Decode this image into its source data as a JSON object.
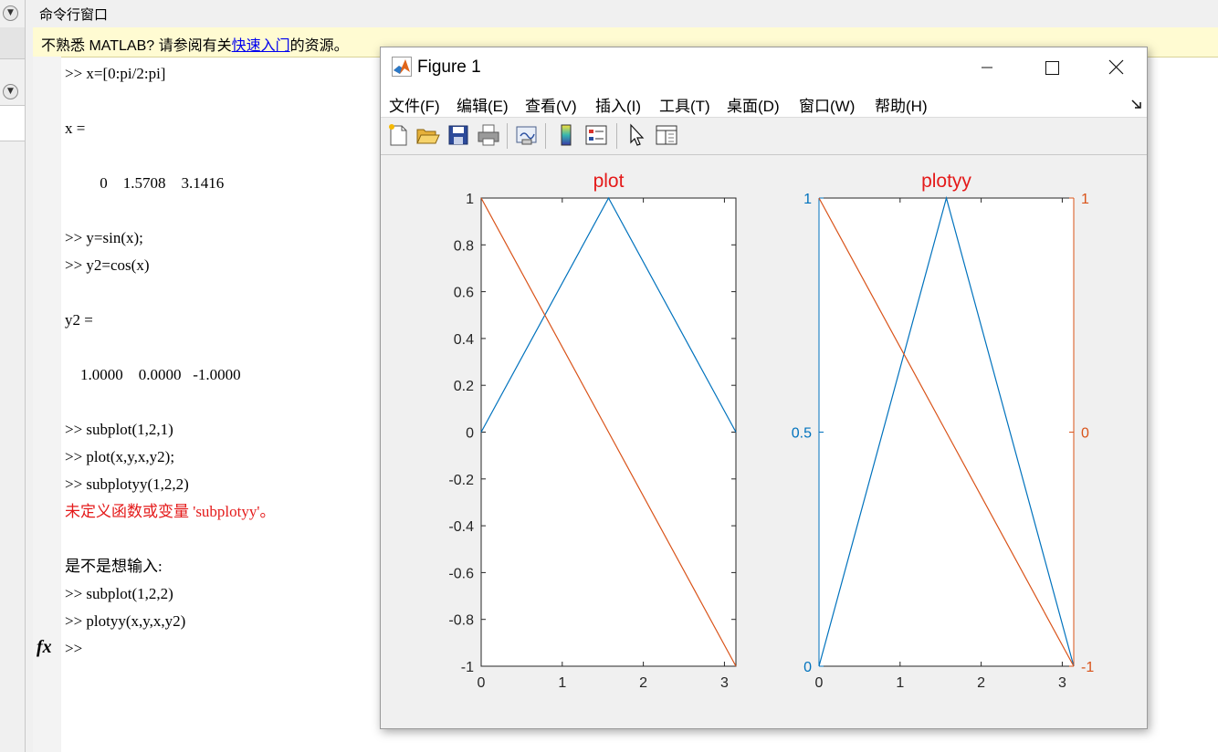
{
  "command_window": {
    "title": "命令行窗口",
    "info_prefix": "不熟悉 MATLAB? 请参阅有关",
    "info_link": "快速入门",
    "info_suffix": "的资源。",
    "lines": [
      ">> x=[0:pi/2:pi]",
      "x =",
      "         0    1.5708    3.1416",
      ">> y=sin(x);",
      ">> y2=cos(x)",
      "y2 =",
      "    1.0000    0.0000   -1.0000",
      ">> subplot(1,2,1)",
      ">> plot(x,y,x,y2);",
      ">> subplotyy(1,2,2)",
      "未定义函数或变量 'subplotyy'。",
      "是不是想输入:",
      ">> subplot(1,2,2)",
      ">> plotyy(x,y,x,y2)"
    ],
    "prompt": ">>",
    "fx_label": "fx"
  },
  "figure_window": {
    "title": "Figure 1",
    "menu": [
      "文件(F)",
      "编辑(E)",
      "查看(V)",
      "插入(I)",
      "工具(T)",
      "桌面(D)",
      "窗口(W)",
      "帮助(H)"
    ],
    "toolbar_icons": [
      "new-figure-icon",
      "open-file-icon",
      "save-icon",
      "print-icon",
      "link-plot-icon",
      "insert-colorbar-icon",
      "insert-legend-icon",
      "edit-plot-pointer-icon",
      "property-inspector-icon"
    ]
  },
  "colors": {
    "blue": "#0072bd",
    "orange": "#d95319",
    "title_red": "#e41a1a"
  },
  "chart_data": [
    {
      "type": "line",
      "title": "plot",
      "x": [
        0,
        1.5708,
        3.1416
      ],
      "series": [
        {
          "values": [
            0,
            1,
            0
          ],
          "color": "#0072bd"
        },
        {
          "values": [
            1,
            0,
            -1
          ],
          "color": "#d95319"
        }
      ],
      "xlim": [
        0,
        3.1416
      ],
      "ylim": [
        -1,
        1
      ],
      "xticks": [
        "0",
        "1",
        "2",
        "3"
      ],
      "yticks": [
        "1",
        "0.8",
        "0.6",
        "0.4",
        "0.2",
        "0",
        "-0.2",
        "-0.4",
        "-0.6",
        "-0.8",
        "-1"
      ],
      "grid": false
    },
    {
      "type": "line",
      "title": "plotyy",
      "x": [
        0,
        1.5708,
        3.1416
      ],
      "series": [
        {
          "values": [
            0,
            1,
            0
          ],
          "axis": "left",
          "color": "#0072bd"
        },
        {
          "values": [
            1,
            0,
            -1
          ],
          "axis": "right",
          "color": "#d95319"
        }
      ],
      "xlim": [
        0,
        3.1416
      ],
      "ylim_left": [
        0,
        1
      ],
      "ylim_right": [
        -1,
        1
      ],
      "xticks": [
        "0",
        "1",
        "2",
        "3"
      ],
      "yticks_left": [
        "1",
        "0.5",
        "0"
      ],
      "yticks_right": [
        "1",
        "0",
        "-1"
      ],
      "grid": false
    }
  ]
}
